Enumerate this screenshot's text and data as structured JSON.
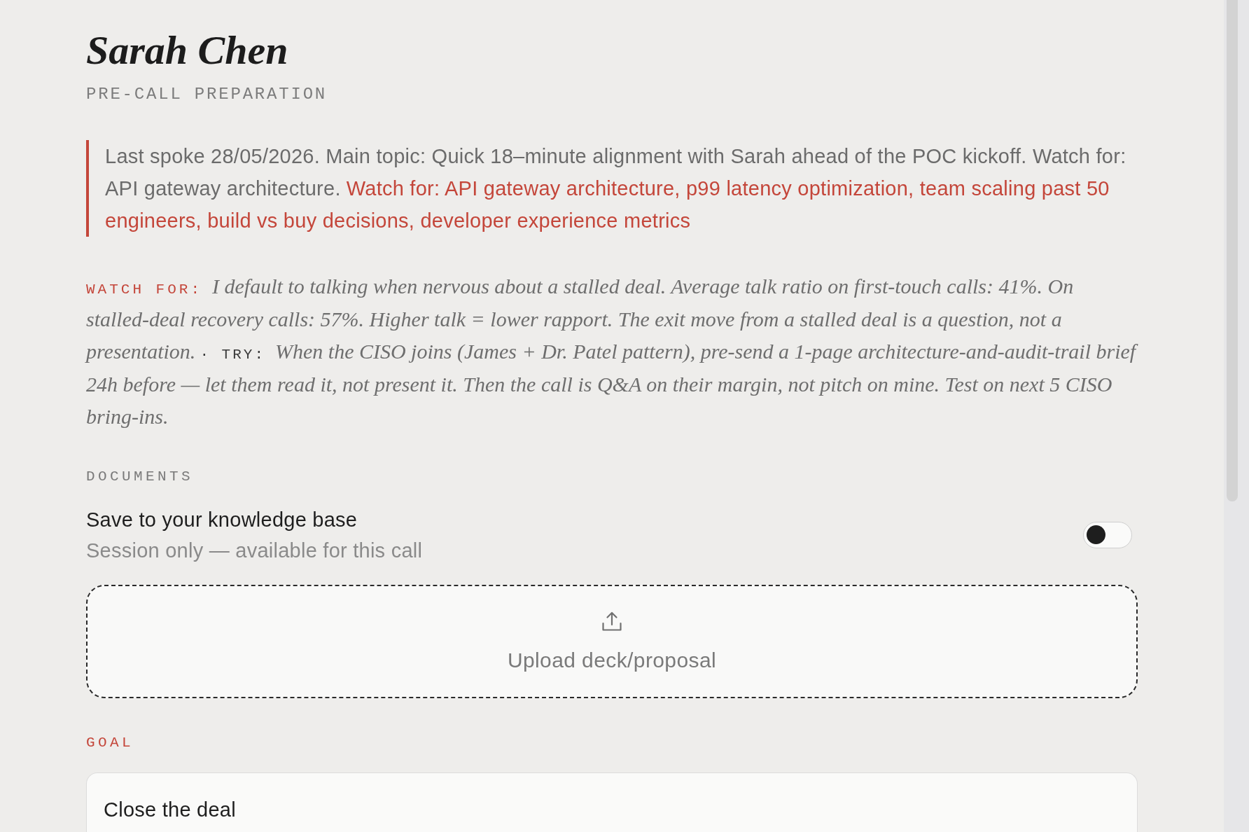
{
  "contact": {
    "name": "Sarah Chen",
    "subtitle": "PRE-CALL PREPARATION"
  },
  "last_call_note": {
    "summary": "Last spoke 28/05/2026. Main topic: Quick 18–minute alignment with Sarah ahead of the POC kickoff. Watch for: API gateway architecture.",
    "highlight": "Watch for: API gateway architecture, p99 latency optimization, team scaling past 50 engineers, build vs buy decisions, developer experience metrics"
  },
  "coaching": {
    "watch_label": "WATCH FOR:",
    "watch_text": "I default to talking when nervous about a stalled deal. Average talk ratio on first-touch calls: 41%. On stalled-deal recovery calls: 57%. Higher talk = lower rapport. The exit move from a stalled deal is a question, not a presentation.",
    "try_label": "· TRY:",
    "try_text": "When the CISO joins (James + Dr. Patel pattern), pre-send a 1-page architecture-and-audit-trail brief 24h before — let them read it, not present it. Then the call is Q&A on their margin, not pitch on mine. Test on next 5 CISO bring-ins."
  },
  "documents": {
    "heading": "DOCUMENTS",
    "save_toggle": {
      "label": "Save to your knowledge base",
      "description": "Session only — available for this call",
      "on": false
    },
    "upload": {
      "label": "Upload deck/proposal"
    }
  },
  "goal": {
    "heading": "GOAL",
    "value": "Close the deal"
  }
}
